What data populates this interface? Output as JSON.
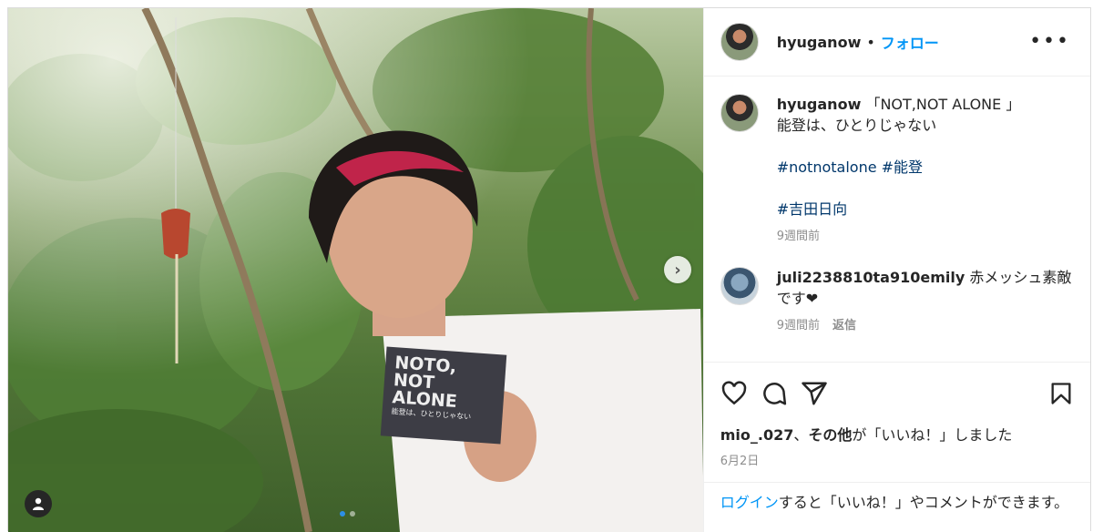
{
  "post": {
    "username": "hyuganow",
    "separator": "•",
    "follow_label": "フォロー",
    "more_label": "•••",
    "next_arrow": "›",
    "tag_icon": "person-icon",
    "badge_text": {
      "line1": "NOTO,",
      "line2": "NOT",
      "line3": "ALONE",
      "line4": "能登は、ひとりじゃない"
    }
  },
  "caption": {
    "username": "hyuganow",
    "text_line1": "「NOT,NOT ALONE 」",
    "text_line2": "能登は、ひとりじゃない",
    "hashtags_line": "#notnotalone #能登",
    "hashtag2": "#吉田日向",
    "time": "9週間前"
  },
  "comment": {
    "username": "juli2238810ta910emily",
    "text": "赤メッシュ素敵です❤",
    "time": "9週間前",
    "reply_label": "返信"
  },
  "likes": {
    "user": "mio_.027",
    "sep": "、",
    "others": "その他",
    "suffix": "が「いいね！」しました",
    "date": "6月2日"
  },
  "login_prompt": {
    "link": "ログイン",
    "text": "すると「いいね！」やコメントができます。"
  },
  "colors": {
    "link": "#0095f6",
    "hashtag": "#00376b",
    "meta": "#8e8e8e"
  }
}
